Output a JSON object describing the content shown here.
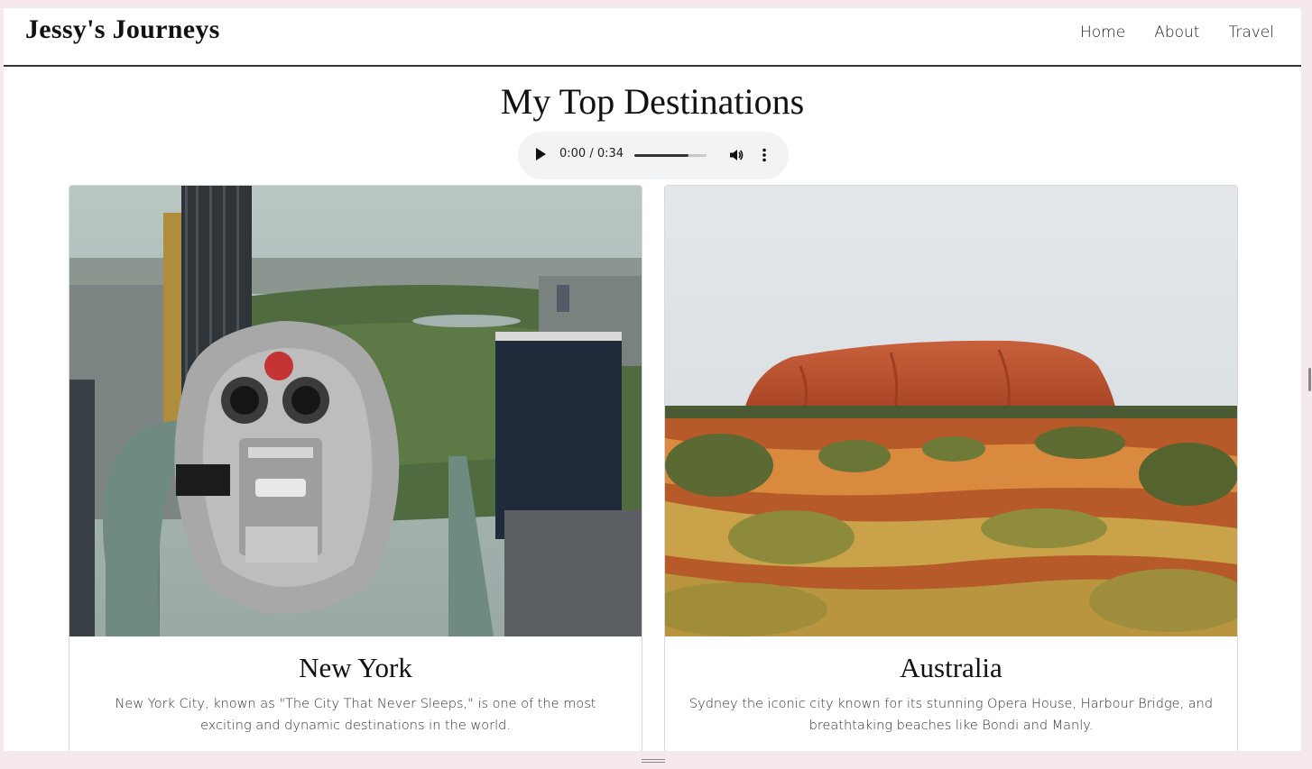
{
  "header": {
    "brand": "Jessy's Journeys",
    "nav": [
      "Home",
      "About",
      "Travel"
    ]
  },
  "main": {
    "title": "My Top Destinations",
    "audio": {
      "time": "0:00 / 0:34",
      "volume_level": 0.75
    },
    "destinations": [
      {
        "name": "New York",
        "description": "New York City, known as \"The City That Never Sleeps,\" is one of the most exciting and dynamic destinations in the world.",
        "photo": "viewing-binoculars-over-central-park"
      },
      {
        "name": "Australia",
        "description": "Sydney the iconic city known for its stunning Opera House, Harbour Bridge, and breathtaking beaches like Bondi and Manly.",
        "photo": "uluru-red-desert"
      }
    ]
  },
  "icons": {
    "play": "play-icon",
    "volume": "volume-icon",
    "more": "more-vertical-icon"
  }
}
